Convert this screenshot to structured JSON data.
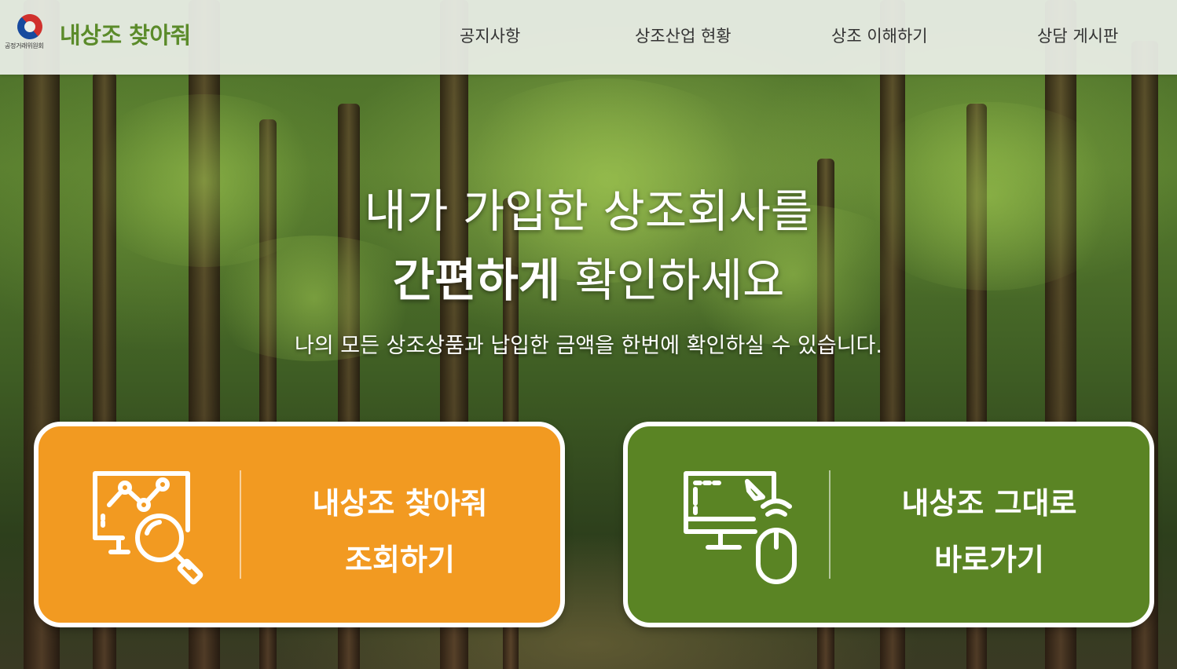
{
  "header": {
    "org_name": "공정거래위원회",
    "site_title": "내상조 찾아줘",
    "nav": [
      {
        "label": "공지사항"
      },
      {
        "label": "상조산업 현황"
      },
      {
        "label": "상조 이해하기"
      },
      {
        "label": "상담 게시판"
      }
    ]
  },
  "hero": {
    "line1": "내가 가입한 상조회사를",
    "line2_bold": "간편하게",
    "line2_rest": " 확인하세요",
    "subtitle": "나의 모든 상조상품과 납입한 금액을 한번에 확인하실 수 있습니다."
  },
  "cards": [
    {
      "line1": "내상조 찾아줘",
      "line2": "조회하기",
      "icon": "search-analytics-icon",
      "color": "#f29a21"
    },
    {
      "line1": "내상조 그대로",
      "line2": "바로가기",
      "icon": "computer-mouse-icon",
      "color": "#5a8424"
    }
  ],
  "colors": {
    "brand_green": "#5b8b2a",
    "header_bg": "#ecf0e8"
  }
}
